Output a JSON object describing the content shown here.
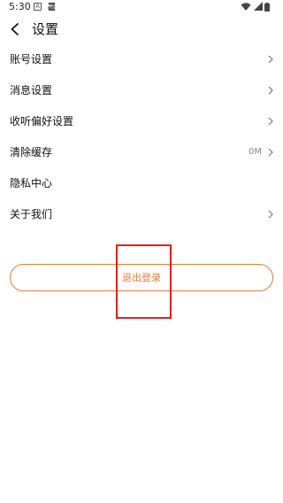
{
  "status_bar": {
    "time": "5:30",
    "notification_a_glyph": "A",
    "icons": [
      "notification-a-icon",
      "stack-icon",
      "wifi-icon",
      "signal-icon",
      "battery-icon"
    ]
  },
  "header": {
    "back_icon": "chevron-left-icon",
    "title": "设置"
  },
  "menu": {
    "items": [
      {
        "label": "账号设置",
        "value": "",
        "chevron": true
      },
      {
        "label": "消息设置",
        "value": "",
        "chevron": true
      },
      {
        "label": "收听偏好设置",
        "value": "",
        "chevron": true
      },
      {
        "label": "清除缓存",
        "value": "0M",
        "chevron": true
      },
      {
        "label": "隐私中心",
        "value": "",
        "chevron": false
      },
      {
        "label": "关于我们",
        "value": "",
        "chevron": true
      }
    ]
  },
  "logout": {
    "label": "退出登录"
  },
  "colors": {
    "accent": "#e07d3f",
    "highlight": "#e02020",
    "text": "#111111",
    "secondary_text": "#888888"
  }
}
